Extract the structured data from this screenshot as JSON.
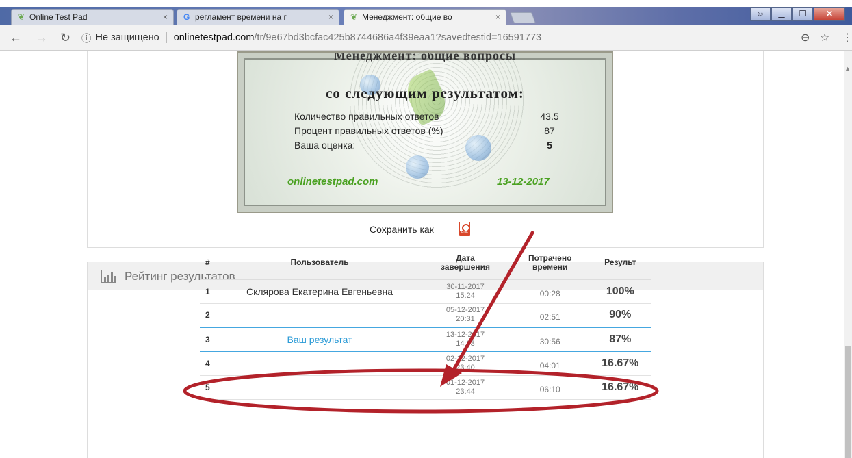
{
  "browser": {
    "tabs": [
      {
        "title": "Online Test Pad",
        "icon": "testpad-favicon"
      },
      {
        "title": "регламент времени на г",
        "icon": "google-favicon"
      },
      {
        "title": "Менеджмент: общие во",
        "icon": "testpad-favicon"
      }
    ],
    "close_glyph": "×",
    "security_label": "Не защищено",
    "url_host": "onlinetestpad.com",
    "url_path": "/tr/9e67bd3bcfac425b8744686a4f39eaa1?savedtestid=16591773"
  },
  "certificate": {
    "heading_cut": "Менеджмент: общие вопросы",
    "heading": "со следующим результатом:",
    "rows": [
      {
        "label": "Количество правильных ответов",
        "value": "43.5"
      },
      {
        "label": "Процент правильных ответов (%)",
        "value": "87"
      },
      {
        "label": "Ваша оценка:",
        "value": "5"
      }
    ],
    "site": "onlinetestpad.com",
    "date": "13-12-2017"
  },
  "save": {
    "label": "Сохранить как",
    "pdf_text": "PDF"
  },
  "rating": {
    "title": "Рейтинг результатов",
    "columns": {
      "num": "#",
      "user": "Пользователь",
      "date_line1": "Дата",
      "date_line2": "завершения",
      "spent_line1": "Потрачено",
      "spent_line2": "времени",
      "result": "Результ"
    },
    "rows": [
      {
        "num": "1",
        "user": "Склярова Екатерина Евгеньевна",
        "date": "30-11-2017",
        "time": "15:24",
        "spent": "00:28",
        "result": "100%"
      },
      {
        "num": "2",
        "user": "",
        "date": "05-12-2017",
        "time": "20:31",
        "spent": "02:51",
        "result": "90%"
      },
      {
        "num": "3",
        "user": "Ваш результат",
        "date": "13-12-2017",
        "time": "14:03",
        "spent": "30:56",
        "result": "87%"
      },
      {
        "num": "4",
        "user": "",
        "date": "02-12-2017",
        "time": "23:40",
        "spent": "04:01",
        "result": "16.67%"
      },
      {
        "num": "5",
        "user": "",
        "date": "01-12-2017",
        "time": "23:44",
        "spent": "06:10",
        "result": "16.67%"
      }
    ]
  },
  "colors": {
    "annotation": "#b3222a",
    "highlight": "#45a7e0",
    "site_green": "#4aa121"
  }
}
